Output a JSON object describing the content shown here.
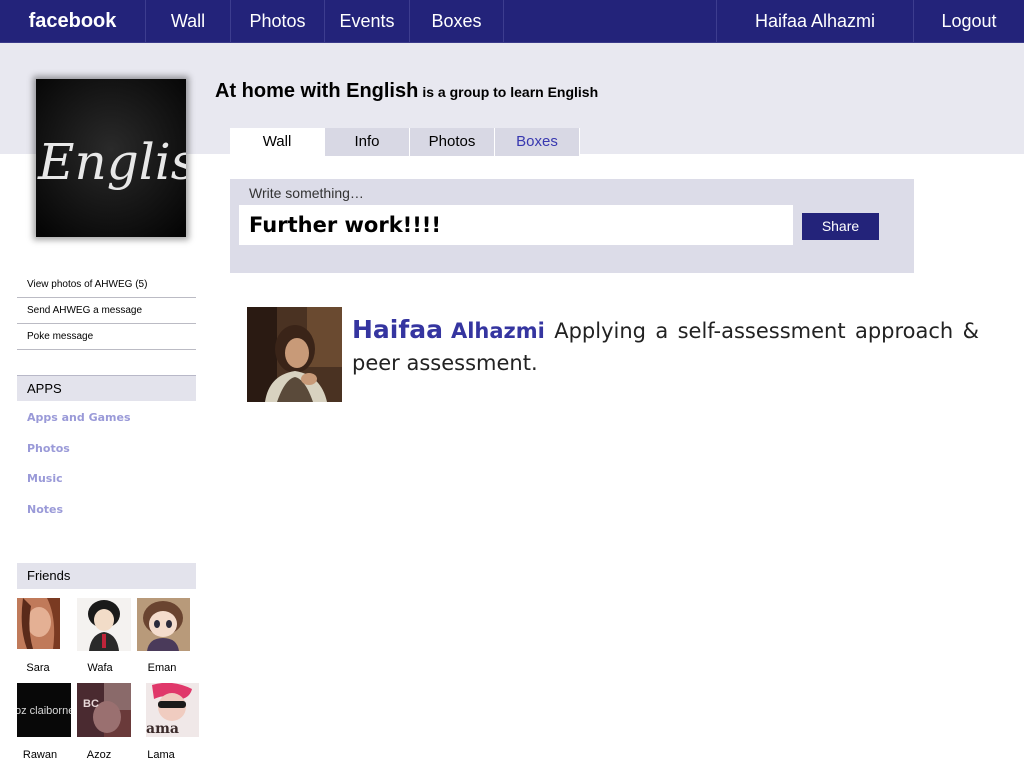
{
  "topbar": {
    "logo": "facebook",
    "nav": [
      "Wall",
      "Photos",
      "Events",
      "Boxes"
    ],
    "user": "Haifaa  Alhazmi",
    "logout": "Logout"
  },
  "group": {
    "name": "At home with English",
    "description": "is a group to  learn English",
    "image_text": "English"
  },
  "tabs": [
    "Wall",
    "Info",
    "Photos",
    "Boxes"
  ],
  "composer": {
    "label": "Write something…",
    "value": "Further work!!!!",
    "share": "Share"
  },
  "post": {
    "author_first": "Haifaa",
    "author_last": "Alhazmi",
    "text": "Applying a self-assessment approach & peer assessment."
  },
  "side_links": [
    "View photos of AHWEG (5)",
    "Send AHWEG a message",
    "Poke message"
  ],
  "apps": {
    "heading": "APPS",
    "items": [
      "Apps and Games",
      "Photos",
      "Music",
      "Notes"
    ]
  },
  "friends": {
    "heading": "Friends",
    "list": [
      {
        "name": "Sara"
      },
      {
        "name": "Wafa"
      },
      {
        "name": "Eman"
      },
      {
        "name": "Rawan",
        "photo_text": "oz claiborne"
      },
      {
        "name": "Azoz",
        "photo_text": "BC"
      },
      {
        "name": "Lama",
        "photo_text": "ama"
      }
    ]
  },
  "colors": {
    "topbar": "#23237a",
    "band": "#e8e8f0",
    "link": "#9a9ad8",
    "author": "#3535a0"
  }
}
